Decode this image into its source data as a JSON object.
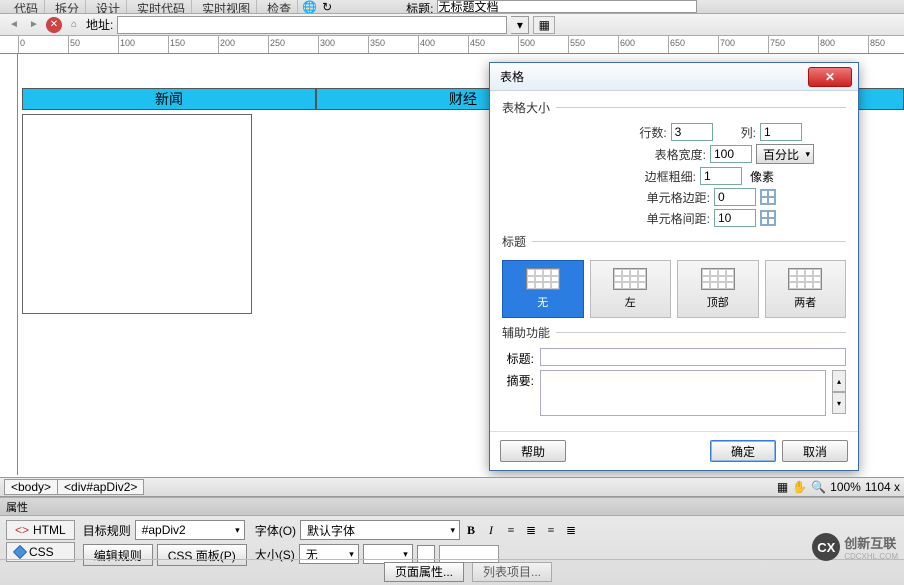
{
  "toolbar": {
    "buttons": [
      "代码",
      "拆分",
      "设计",
      "实时代码",
      "实时视图",
      "检查"
    ],
    "title_label": "标题:",
    "title_value": "无标题文档"
  },
  "addressbar": {
    "label": "地址:",
    "value": ""
  },
  "ruler_marks": [
    0,
    50,
    100,
    150,
    200,
    250,
    300,
    350,
    400,
    450,
    500,
    550,
    600,
    650,
    700,
    750,
    800,
    850
  ],
  "page_tabs": {
    "cells": [
      "新闻",
      "财经",
      ""
    ]
  },
  "dialog": {
    "title": "表格",
    "section_size": "表格大小",
    "rows_label": "行数:",
    "rows_value": "3",
    "cols_label": "列:",
    "cols_value": "1",
    "width_label": "表格宽度:",
    "width_value": "100",
    "width_unit": "百分比",
    "border_label": "边框粗细:",
    "border_value": "1",
    "border_unit": "像素",
    "cellpad_label": "单元格边距:",
    "cellpad_value": "0",
    "cellspace_label": "单元格间距:",
    "cellspace_value": "10",
    "section_caption": "标题",
    "caption_options": [
      "无",
      "左",
      "顶部",
      "两者"
    ],
    "section_access": "辅助功能",
    "caption_field_label": "标题:",
    "summary_label": "摘要:",
    "help_btn": "帮助",
    "ok_btn": "确定",
    "cancel_btn": "取消"
  },
  "tagbar": {
    "tags": [
      "<body>",
      "<div#apDiv2>"
    ],
    "zoom": "100%",
    "coords": "1104 x"
  },
  "properties": {
    "title": "属性",
    "html_tab": "HTML",
    "css_tab": "CSS",
    "target_rule_label": "目标规则",
    "target_rule_value": "#apDiv2",
    "edit_rule_btn": "编辑规则",
    "css_panel_btn": "CSS 面板(P)",
    "font_label": "字体(O)",
    "font_value": "默认字体",
    "size_label": "大小(S)",
    "size_value": "无",
    "page_props_btn": "页面属性...",
    "list_item_btn": "列表项目..."
  },
  "watermark": {
    "text": "创新互联",
    "sub": "CDCXHL.COM"
  }
}
